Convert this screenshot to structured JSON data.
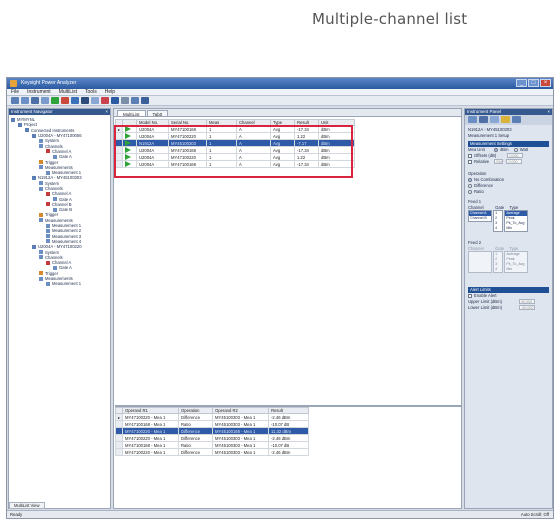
{
  "callout": {
    "label": "Multiple-channel list"
  },
  "app": {
    "title": "Keysight Power Analyzer",
    "menu": [
      "File",
      "Instrument",
      "MultiList",
      "Tools",
      "Help"
    ],
    "window_controls": [
      "_",
      "□",
      "×"
    ]
  },
  "navigator": {
    "header": "Instrument Navigator",
    "items": [
      {
        "indent": 0,
        "label": "MYMYNL",
        "icon": "computer-icon",
        "color": "#5b7fb5"
      },
      {
        "indent": 1,
        "label": "Project",
        "icon": "project-icon",
        "color": "#5b7fb5"
      },
      {
        "indent": 2,
        "label": "Connected Instruments",
        "icon": "instrument-icon",
        "color": "#5b7fb5"
      },
      {
        "indent": 3,
        "label": "U2004A - MY47100056",
        "icon": "sensor-icon",
        "color": "#5b7fb5"
      },
      {
        "indent": 4,
        "label": "System",
        "icon": "system-icon",
        "color": "#6b8fc5"
      },
      {
        "indent": 4,
        "label": "Channels",
        "icon": "channel-icon",
        "color": "#6b8fc5"
      },
      {
        "indent": 5,
        "label": "Channel A",
        "icon": "channel-icon",
        "color": "#c23a3a"
      },
      {
        "indent": 6,
        "label": "Gate A",
        "icon": "gate-icon",
        "color": "#6b8fc5"
      },
      {
        "indent": 4,
        "label": "Trigger",
        "icon": "trigger-icon",
        "color": "#d88a2a"
      },
      {
        "indent": 4,
        "label": "Measurements",
        "icon": "measurement-icon",
        "color": "#6b8fc5"
      },
      {
        "indent": 5,
        "label": "Measurement 1",
        "icon": "measurement-icon",
        "color": "#6b8fc5"
      },
      {
        "indent": 3,
        "label": "N1912A - MY45100303",
        "icon": "meter-icon",
        "color": "#5b7fb5"
      },
      {
        "indent": 4,
        "label": "System",
        "icon": "system-icon",
        "color": "#6b8fc5"
      },
      {
        "indent": 4,
        "label": "Channels",
        "icon": "channel-icon",
        "color": "#6b8fc5"
      },
      {
        "indent": 5,
        "label": "Channel A",
        "icon": "channel-icon",
        "color": "#c23a3a"
      },
      {
        "indent": 6,
        "label": "Gate A",
        "icon": "gate-icon",
        "color": "#6b8fc5"
      },
      {
        "indent": 5,
        "label": "Channel B",
        "icon": "channel-icon",
        "color": "#c23a3a"
      },
      {
        "indent": 6,
        "label": "Gate B",
        "icon": "gate-icon",
        "color": "#6b8fc5"
      },
      {
        "indent": 4,
        "label": "Trigger",
        "icon": "trigger-icon",
        "color": "#d88a2a"
      },
      {
        "indent": 4,
        "label": "Measurements",
        "icon": "measurement-icon",
        "color": "#6b8fc5"
      },
      {
        "indent": 5,
        "label": "Measurement 1",
        "icon": "measurement-icon",
        "color": "#6b8fc5"
      },
      {
        "indent": 5,
        "label": "Measurement 2",
        "icon": "measurement-icon",
        "color": "#6b8fc5"
      },
      {
        "indent": 5,
        "label": "Measurement 3",
        "icon": "measurement-icon",
        "color": "#6b8fc5"
      },
      {
        "indent": 5,
        "label": "Measurement 4",
        "icon": "measurement-icon",
        "color": "#6b8fc5"
      },
      {
        "indent": 3,
        "label": "U2004A - MY47100220",
        "icon": "sensor-icon",
        "color": "#5b7fb5"
      },
      {
        "indent": 4,
        "label": "System",
        "icon": "system-icon",
        "color": "#6b8fc5"
      },
      {
        "indent": 4,
        "label": "Channels",
        "icon": "channel-icon",
        "color": "#6b8fc5"
      },
      {
        "indent": 5,
        "label": "Channel A",
        "icon": "channel-icon",
        "color": "#c23a3a"
      },
      {
        "indent": 6,
        "label": "Gate A",
        "icon": "gate-icon",
        "color": "#6b8fc5"
      },
      {
        "indent": 4,
        "label": "Trigger",
        "icon": "trigger-icon",
        "color": "#d88a2a"
      },
      {
        "indent": 4,
        "label": "Measurements",
        "icon": "measurement-icon",
        "color": "#6b8fc5"
      },
      {
        "indent": 5,
        "label": "Measurement 1",
        "icon": "measurement-icon",
        "color": "#6b8fc5"
      }
    ]
  },
  "center": {
    "tabs": [
      "MultiList",
      "Tab0"
    ],
    "grid": {
      "columns": [
        "Model No.",
        "Serial No.",
        "Meas",
        "Channel",
        "Type",
        "Result",
        "Unit"
      ],
      "rows": [
        {
          "model": "U2004A",
          "serial": "MY47100168",
          "meas": "1",
          "channel": "A",
          "type": "Avg",
          "result": "-17.34",
          "unit": "dBm",
          "selected": false
        },
        {
          "model": "U2004A",
          "serial": "MY47100220",
          "meas": "1",
          "channel": "A",
          "type": "Avg",
          "result": "1.22",
          "unit": "dBm",
          "selected": false
        },
        {
          "model": "N1912A",
          "serial": "MY45100303",
          "meas": "1",
          "channel": "A",
          "type": "Avg",
          "result": "-7.17",
          "unit": "dBm",
          "selected": true
        },
        {
          "model": "U2004A",
          "serial": "MY47100168",
          "meas": "1",
          "channel": "A",
          "type": "Avg",
          "result": "-17.34",
          "unit": "dBm",
          "selected": false
        },
        {
          "model": "U2004A",
          "serial": "MY47100220",
          "meas": "1",
          "channel": "A",
          "type": "Avg",
          "result": "1.22",
          "unit": "dBm",
          "selected": false
        },
        {
          "model": "U2004A",
          "serial": "MY47100168",
          "meas": "1",
          "channel": "A",
          "type": "Avg",
          "result": "-17.34",
          "unit": "dBm",
          "selected": false
        }
      ]
    },
    "operations": {
      "columns": [
        "Operand R1",
        "Operation",
        "Operand R2",
        "Result"
      ],
      "rows": [
        {
          "op1": "MY47100220 - Mea 1",
          "op": "Difference",
          "op2": "MY45100303 - Mea 1",
          "result": "-2.46 dBm",
          "selected": false
        },
        {
          "op1": "MY47100168 - Mea 1",
          "op": "Ratio",
          "op2": "MY45100303 - Mea 1",
          "result": "-10.07 dB",
          "selected": false
        },
        {
          "op1": "MY47100220 - Mea 1",
          "op": "Difference",
          "op2": "MY45100168 - Mea 1",
          "result": "11.32 dBm",
          "selected": true
        },
        {
          "op1": "MY47100220 - Mea 1",
          "op": "Difference",
          "op2": "MY45100303 - Mea 1",
          "result": "-2.46 dBm",
          "selected": false
        },
        {
          "op1": "MY47100168 - Mea 1",
          "op": "Ratio",
          "op2": "MY45100303 - Mea 1",
          "result": "-10.07 dB",
          "selected": false
        },
        {
          "op1": "MY47100220 - Mea 1",
          "op": "Difference",
          "op2": "MY45100303 - Mea 1",
          "result": "-2.46 dBm",
          "selected": false
        }
      ]
    }
  },
  "instrument_panel": {
    "header": "Instrument Panel",
    "device": "N1912A - MY45100303",
    "setup_title": "Measurement 1 Setup",
    "settings_group": "Measurement Settings",
    "meas_unit_label": "Mea Unit",
    "unit_dbm": "dBm",
    "unit_watt": "Watt",
    "offsets_label": "Offsets (dB)",
    "offsets_value": "0.000",
    "relative_label": "Relative",
    "relative_btn": "Ref",
    "relative_value": "0.000",
    "operation_label": "Operation",
    "op_options": [
      "No Combination",
      "Difference",
      "Ratio"
    ],
    "feed1_label": "Feed 1",
    "channel_label": "Channel",
    "gate_label": "Gate",
    "type_label": "Type",
    "feed1_channels": [
      "Channel A",
      "Channel B"
    ],
    "feed1_gates": [
      "1",
      "2",
      "3",
      "4"
    ],
    "feed1_types": [
      "Average",
      "Peak",
      "Pk_To_Avg",
      "Min"
    ],
    "feed2_label": "Feed 2",
    "feed2_channels": [],
    "feed2_gates": [
      "1",
      "2",
      "3",
      "4"
    ],
    "feed2_types": [
      "Average",
      "Peak",
      "Pk_To_Avg",
      "Min"
    ],
    "alert_group": "Alert Limits",
    "enable_alert": "Enable Alert",
    "upper_label": "Upper Limit (dBm)",
    "upper_value": "90.000",
    "lower_label": "Lower Limit (dBm)",
    "lower_value": "-90.000"
  },
  "bottom_tab": "MultiList View",
  "status": {
    "left": "Ready",
    "right": "Auto Scroll: Off"
  }
}
